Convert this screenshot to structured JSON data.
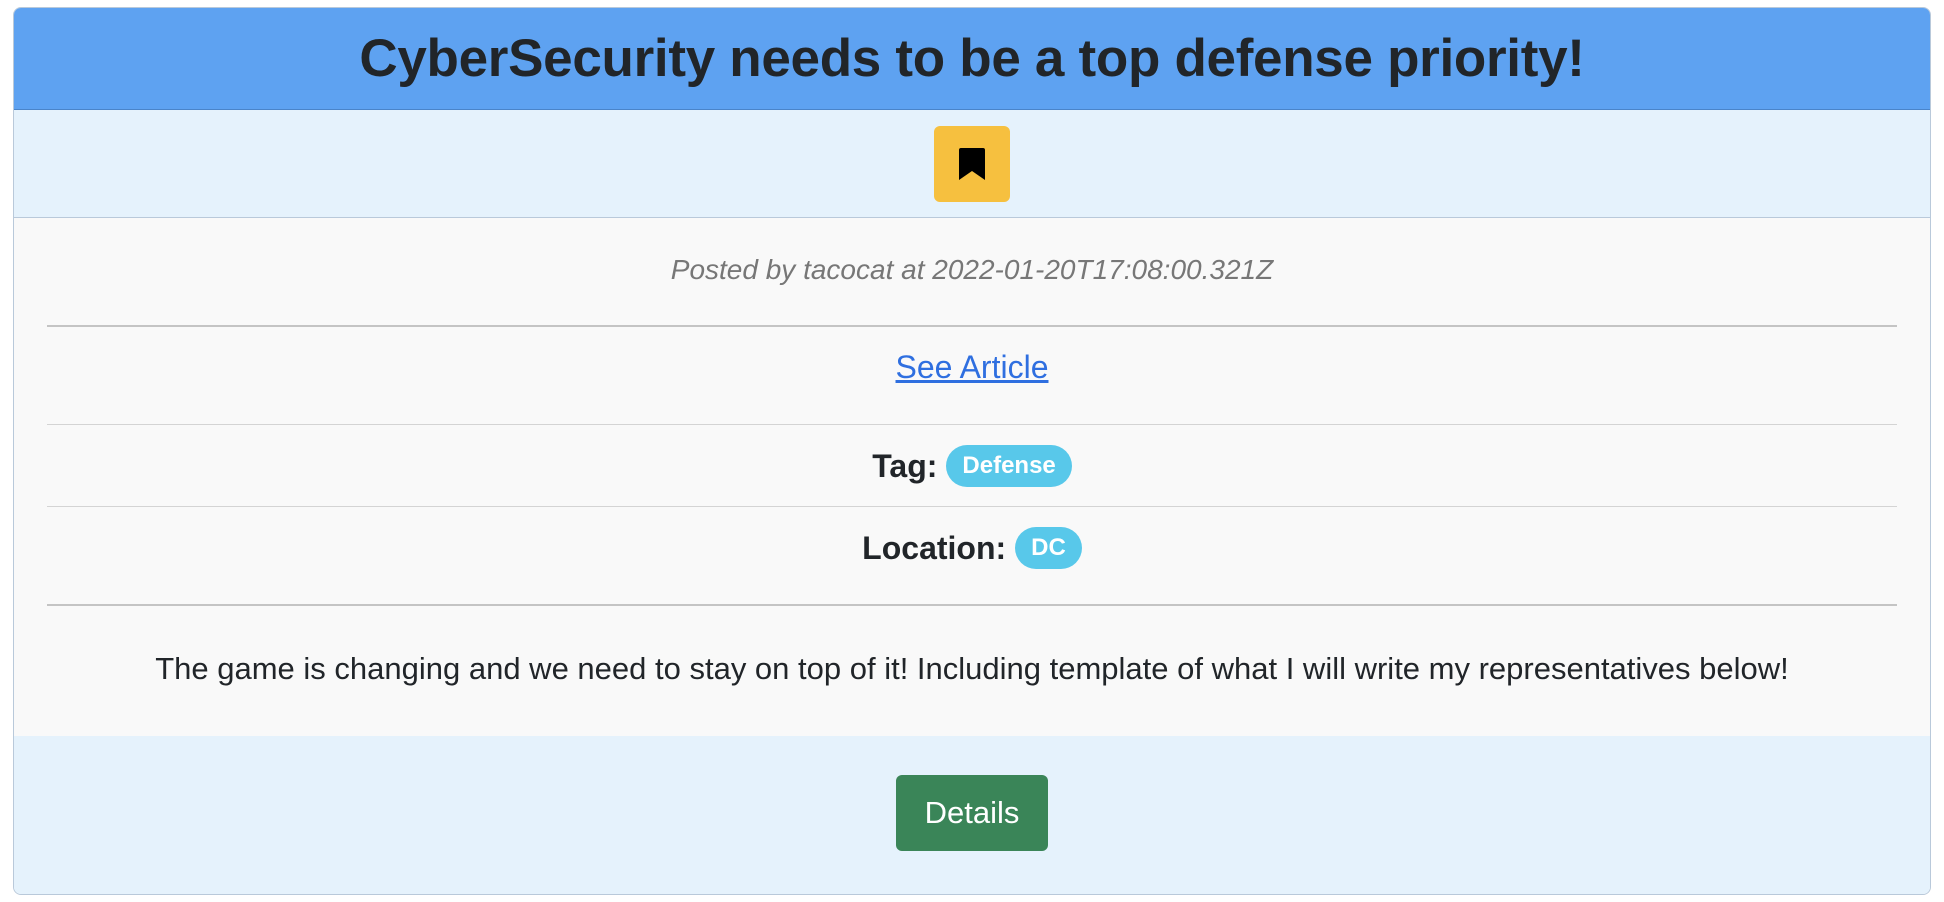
{
  "post": {
    "title": "CyberSecurity needs to be a top defense priority!",
    "meta": "Posted by tacocat at 2022-01-20T17:08:00.321Z",
    "article_link_label": "See Article",
    "tag_label": "Tag:",
    "tag_value": "Defense",
    "location_label": "Location:",
    "location_value": "DC",
    "description": "The game is changing and we need to stay on top of it! Including template of what I will write my representatives below!",
    "details_button_label": "Details",
    "bookmark_icon": "bookmark-icon"
  },
  "colors": {
    "header_bg": "#5ea2f1",
    "band_bg": "#e5f2fc",
    "bookmark_button": "#f6c03f",
    "pill_bg": "#58c8ea",
    "details_button": "#3a8558",
    "link": "#2f6fe0"
  }
}
